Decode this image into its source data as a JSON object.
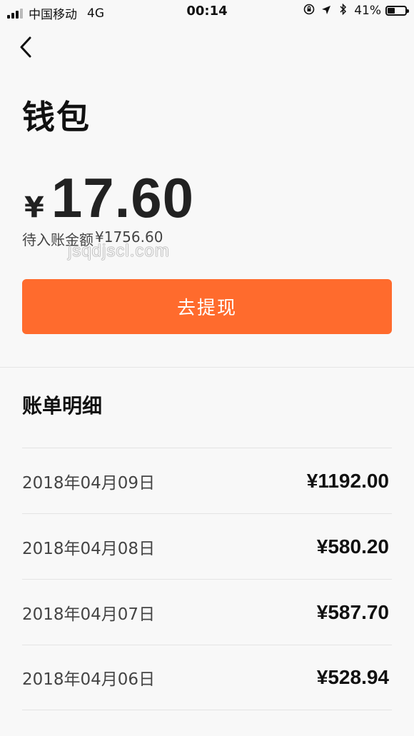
{
  "status_bar": {
    "carrier": "中国移动",
    "network": "4G",
    "time": "00:14",
    "battery_percent": "41%",
    "battery_level": 0.41
  },
  "page": {
    "title": "钱包",
    "currency_symbol": "¥",
    "balance": "17.60",
    "pending_label": "待入账金额",
    "pending_value": "¥1756.60",
    "watermark": "jsqdjscl.com",
    "withdraw_label": "去提现"
  },
  "bills": {
    "title": "账单明细",
    "items": [
      {
        "date": "2018年04月09日",
        "amount": "¥1192.00"
      },
      {
        "date": "2018年04月08日",
        "amount": "¥580.20"
      },
      {
        "date": "2018年04月07日",
        "amount": "¥587.70"
      },
      {
        "date": "2018年04月06日",
        "amount": "¥528.94"
      }
    ]
  },
  "colors": {
    "accent": "#ff6b2d"
  }
}
